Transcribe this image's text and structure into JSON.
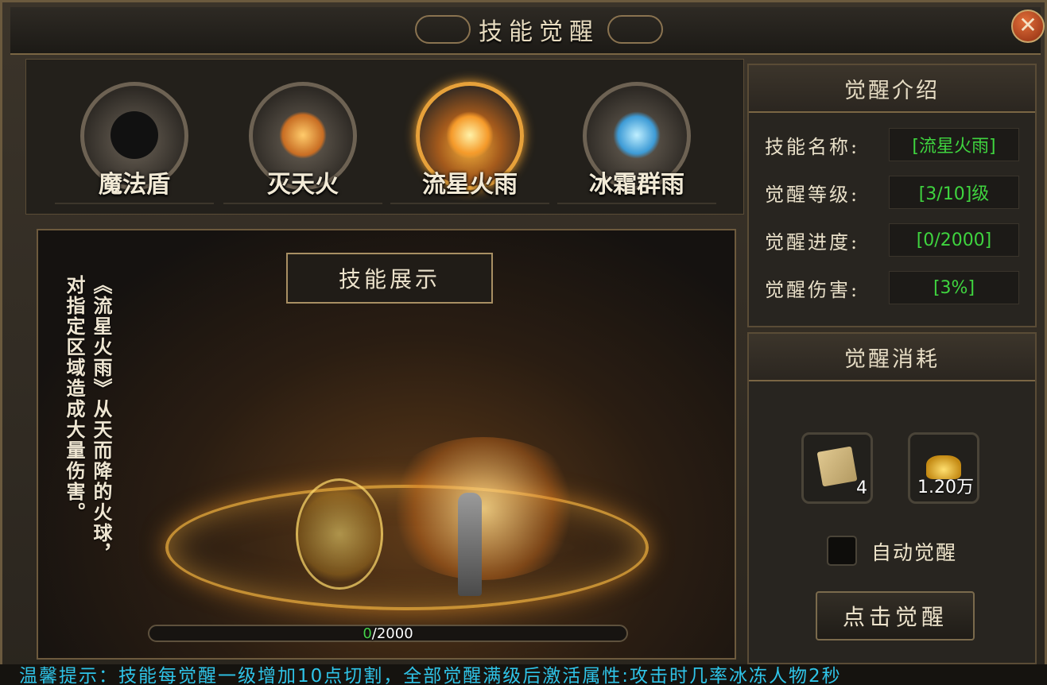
{
  "window": {
    "title": "技能觉醒",
    "close_label": "✕"
  },
  "skills": [
    {
      "name": "魔法盾",
      "selected": false
    },
    {
      "name": "灭天火",
      "selected": false
    },
    {
      "name": "流星火雨",
      "selected": true
    },
    {
      "name": "冰霜群雨",
      "selected": false
    }
  ],
  "preview": {
    "title": "技能展示",
    "description_line1": "《流星火雨》从天而降的火球，",
    "description_line2": "对指定区域造成大量伤害。",
    "progress_current": "0",
    "progress_total": "/2000",
    "progress_fraction": 0
  },
  "info": {
    "header": "觉醒介绍",
    "rows": [
      {
        "label": "技能名称:",
        "value": "[流星火雨]"
      },
      {
        "label": "觉醒等级:",
        "value": "[3/10]级"
      },
      {
        "label": "觉醒进度:",
        "value": "[0/2000]"
      },
      {
        "label": "觉醒伤害:",
        "value": "[3%]"
      }
    ]
  },
  "cost": {
    "header": "觉醒消耗",
    "items": [
      {
        "icon": "scroll-icon",
        "count": "4"
      },
      {
        "icon": "gold-ingot-icon",
        "count": "1.20万"
      }
    ],
    "auto_label": "自动觉醒",
    "button_label": "点击觉醒"
  },
  "tip": "温馨提示：技能每觉醒一级增加10点切割，全部觉醒满级后激活属性:攻击时几率冰冻人物2秒"
}
